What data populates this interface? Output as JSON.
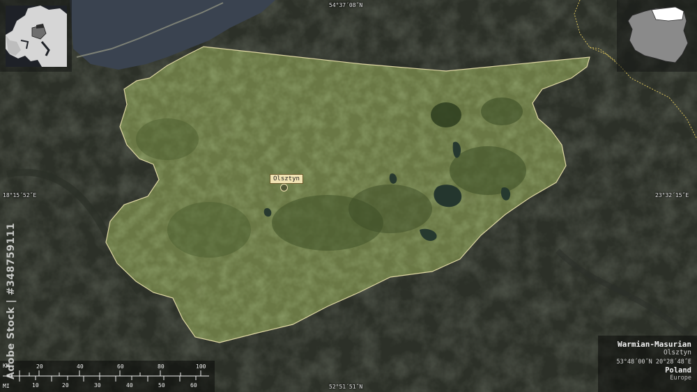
{
  "map": {
    "coords": {
      "top": "54°37´08˝N",
      "bottom": "52°51´51˝N",
      "left": "18°15´52˝E",
      "right": "23°32´15˝E"
    },
    "city": "Olsztyn",
    "info": {
      "title": "Warmian-Masurian",
      "capital": "Olsztyn",
      "coords": "53°48´00˝N 20°28´48˝E",
      "country": "Poland",
      "continent": "Europe"
    },
    "scale": {
      "km_unit": "KM",
      "mi_unit": "MI",
      "km_ticks": [
        "20",
        "40",
        "60",
        "80",
        "100"
      ],
      "mi_ticks": [
        "10",
        "20",
        "30",
        "40",
        "50",
        "60"
      ]
    },
    "watermark": "Adobe Stock | #348759111",
    "colors": {
      "region_fill": "#6b7a45",
      "surroundings": "#353a30",
      "sea": "#3b4452",
      "border_highlight": "#efe6b0"
    }
  }
}
